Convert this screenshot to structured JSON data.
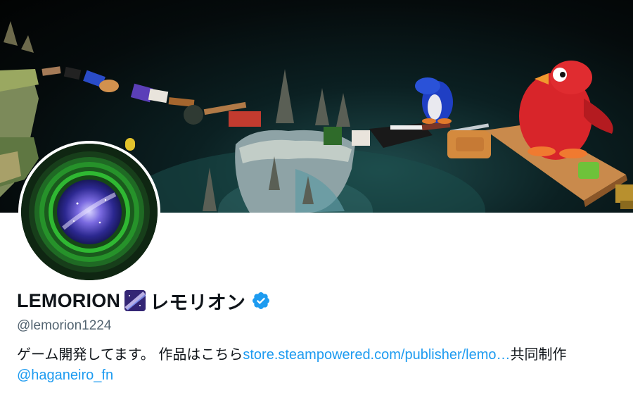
{
  "profile": {
    "name_latin": "LEMORION",
    "name_katakana": "レモリオン",
    "handle": "@lemorion1224",
    "bio_text_1": "ゲーム開発してます。 作品はこちら",
    "bio_link_url": "store.steampowered.com/publisher/lemo…",
    "bio_text_2": "共同制作",
    "bio_mention": "@haganeiro_fn"
  },
  "icons": {
    "name_emoji": "milky-way-emoji",
    "verified": "verified-badge-icon"
  },
  "colors": {
    "link": "#1d9bf0",
    "verified": "#1d9bf0",
    "text": "#0f1419",
    "secondary": "#536471"
  }
}
